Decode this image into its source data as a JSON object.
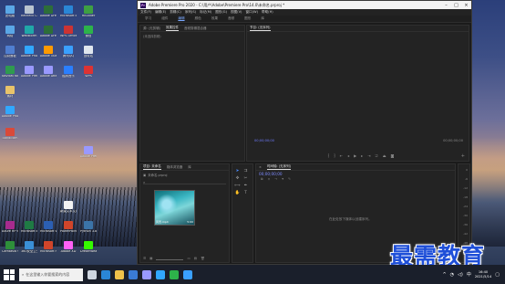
{
  "desktop": {
    "icons": [
      {
        "label": "此电脑",
        "color": "#5aa7e6"
      },
      {
        "label": "Recheck Combine",
        "color": "#b9c4cf"
      },
      {
        "label": "Adobe Dreamweaver",
        "color": "#2d6e39"
      },
      {
        "label": "Microsoft Edge",
        "color": "#2a86d6"
      },
      {
        "label": "HBuilder",
        "color": "#3ea043"
      },
      {
        "label": "网络",
        "color": "#5aa7e6"
      },
      {
        "label": "webstorm",
        "color": "#20a8a8"
      },
      {
        "label": "Adobe Dreamweaver",
        "color": "#2d6e39"
      },
      {
        "label": "WPS Office",
        "color": "#c33"
      },
      {
        "label": "微信",
        "color": "#2db34a"
      },
      {
        "label": "控制面板",
        "color": "#4f7fd0"
      },
      {
        "label": "Adobe Photoshop",
        "color": "#31a8ff"
      },
      {
        "label": "Adobe Illustrator",
        "color": "#ff9a00"
      },
      {
        "label": "腾讯QQ",
        "color": "#3aa0ff"
      },
      {
        "label": "回收站",
        "color": "#dfe6ee"
      },
      {
        "label": "Navicat for MySQL",
        "color": "#2f9b4f"
      },
      {
        "label": "Adobe Premiere",
        "color": "#9999ff"
      },
      {
        "label": "Adobe After Effects",
        "color": "#9999ff"
      },
      {
        "label": "酷狗音乐",
        "color": "#2a7fff"
      },
      {
        "label": "WPS",
        "color": "#d33"
      },
      {
        "label": "Adobe Photoshop",
        "color": "#31a8ff"
      },
      {
        "label": "素材",
        "color": "#e8c36a"
      },
      {
        "label": "Adobe Premiere Pro",
        "color": "#9999ff"
      },
      {
        "label": "Bandicam",
        "color": "#d94a3a"
      },
      {
        "label": "新建文本文档",
        "color": "#f2f2f2"
      },
      {
        "label": "Axure RP 9",
        "color": "#a72b8e"
      },
      {
        "label": "Microsoft Excel 2016",
        "color": "#1f7a44"
      },
      {
        "label": "Microsoft Word 2016",
        "color": "#2b5fb3"
      },
      {
        "label": "PowerPoint",
        "color": "#d0452a"
      },
      {
        "label": "Python 3.8",
        "color": "#3b74a8"
      },
      {
        "label": "Camtasia 9",
        "color": "#2e8f3a"
      },
      {
        "label": "360安全卫士",
        "color": "#3a8fd6"
      },
      {
        "label": "Microsoft PowerPoint",
        "color": "#d0452a"
      },
      {
        "label": "Adobe XD",
        "color": "#ff61f6"
      },
      {
        "label": "Dreamweaver",
        "color": "#35fa00"
      }
    ]
  },
  "premiere": {
    "title": "Adobe Premiere Pro 2020 - C:\\用户\\Adobe\\Premiere Pro\\14.0\\未命名.prproj *",
    "logo": "Pr",
    "menu": [
      "文件(F)",
      "编辑(E)",
      "剪辑(C)",
      "序列(S)",
      "标记(M)",
      "图形(G)",
      "视图(V)",
      "窗口(W)",
      "帮助(H)"
    ],
    "workspaces": [
      "学习",
      "组件",
      "编辑",
      "颜色",
      "效果",
      "音频",
      "图形",
      "库"
    ],
    "active_workspace": "编辑",
    "source_tabs": [
      "源: (无剪辑)",
      "效果控件",
      "音频剪辑混合器"
    ],
    "source_text": "(未选择剪辑)",
    "program_tab": "节目: (无序列)",
    "program_timecode_left": "00;00;00;00",
    "program_timecode_right": "00;00;00;00",
    "project_tabs": [
      "项目: 未命名",
      "媒体浏览器",
      "库"
    ],
    "project_file": "未命名.prproj",
    "clip_name": "风景.mp4",
    "clip_duration": "5:00",
    "timeline_tab": "时间轴: (无序列)",
    "timeline_timecode": "00;00;00;00",
    "timeline_hint": "在此处放下媒体以创建序列。",
    "meter_labels": [
      "0",
      "-6",
      "-12",
      "-18",
      "-24",
      "-30",
      "-36",
      "-42",
      "-48",
      "-54"
    ]
  },
  "taskbar": {
    "search_placeholder": "在这里输入你要搜索的内容",
    "time": "16:40",
    "date": "2021/5/14",
    "apps": [
      {
        "name": "task-view",
        "color": "#cfd6e0"
      },
      {
        "name": "edge",
        "color": "#2a86d6"
      },
      {
        "name": "explorer",
        "color": "#f0c24a"
      },
      {
        "name": "store",
        "color": "#3a7bd5"
      },
      {
        "name": "premiere",
        "color": "#9999ff"
      },
      {
        "name": "photoshop",
        "color": "#31a8ff"
      },
      {
        "name": "wechat",
        "color": "#2db34a"
      },
      {
        "name": "qq",
        "color": "#3aa0ff"
      }
    ]
  },
  "watermark": "最需教育"
}
